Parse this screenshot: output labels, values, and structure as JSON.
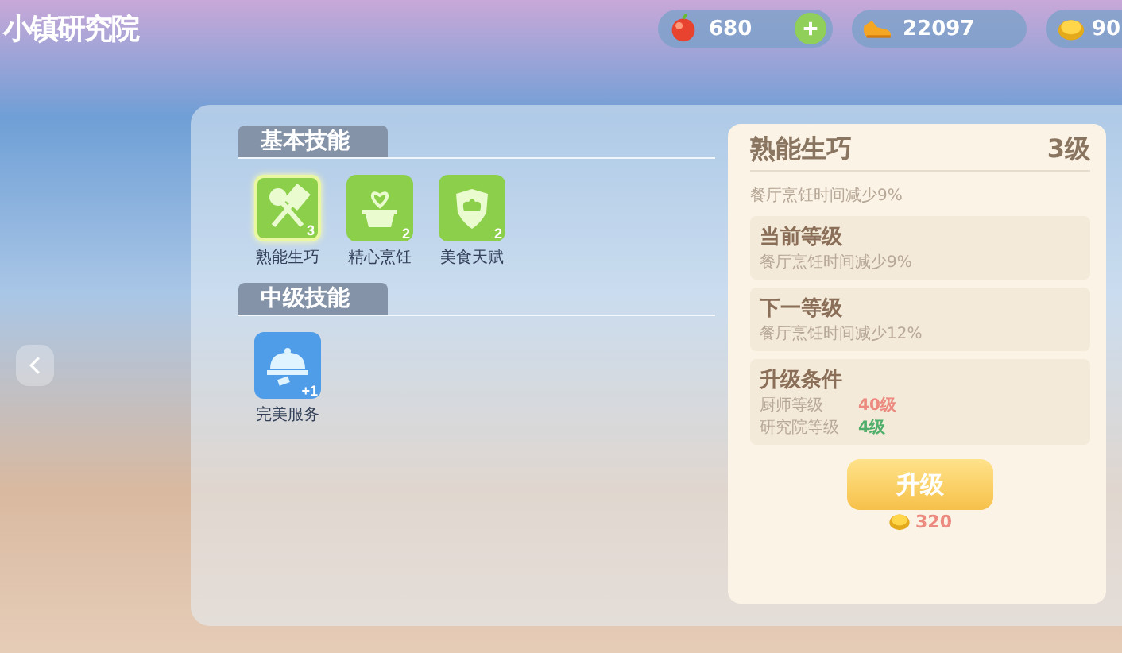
{
  "title": "小镇研究院",
  "currencies": [
    {
      "kind": "apple",
      "amount": "680",
      "addable": true
    },
    {
      "kind": "shoe",
      "amount": "22097",
      "addable": false
    },
    {
      "kind": "coin",
      "amount": "90",
      "addable": false
    }
  ],
  "sections": [
    {
      "title": "基本技能",
      "skills": [
        {
          "name": "熟能生巧",
          "badge": "3",
          "kind": "utensils",
          "color": "#8ccf4a",
          "selected": true
        },
        {
          "name": "精心烹饪",
          "badge": "2",
          "kind": "pot",
          "color": "#8ccf4a",
          "selected": false
        },
        {
          "name": "美食天赋",
          "badge": "2",
          "kind": "crest",
          "color": "#8ccf4a",
          "selected": false
        }
      ]
    },
    {
      "title": "中级技能",
      "skills": [
        {
          "name": "完美服务",
          "badge": "+1",
          "kind": "cloche",
          "color": "#4f9de8",
          "selected": false
        }
      ]
    }
  ],
  "detail": {
    "name": "熟能生巧",
    "level": "3级",
    "description": "餐厅烹饪时间减少9%",
    "blocks": [
      {
        "kind": "text",
        "title": "当前等级",
        "text": "餐厅烹饪时间减少9%"
      },
      {
        "kind": "text",
        "title": "下一等级",
        "text": "餐厅烹饪时间减少12%"
      },
      {
        "kind": "requirements",
        "title": "升级条件",
        "rows": [
          {
            "label": "厨师等级",
            "value": "40级",
            "met": false
          },
          {
            "label": "研究院等级",
            "value": "4级",
            "met": true
          }
        ]
      }
    ],
    "button": "升级",
    "cost": "320"
  }
}
